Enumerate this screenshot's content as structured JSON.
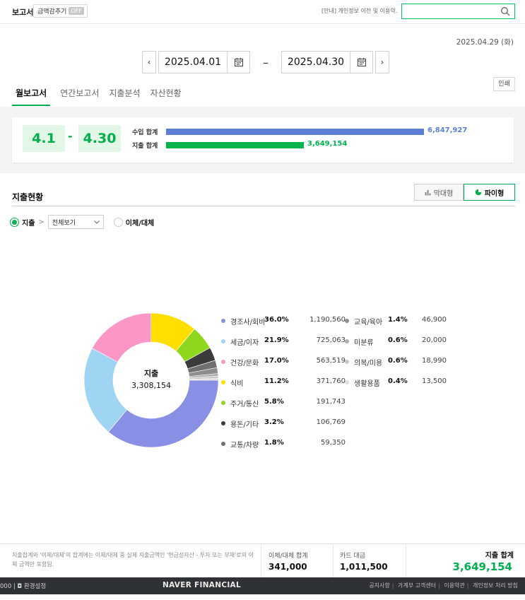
{
  "header": {
    "title": "보고서",
    "toggle_label": "금액감추기",
    "toggle_state": "OFF",
    "notice": "[안내] 개인정보 이전 및 이용약.",
    "search_placeholder": ""
  },
  "today": "2025.04.29 (화)",
  "period": {
    "prev": "‹",
    "start": "2025.04.01",
    "separator": "–",
    "end": "2025.04.30",
    "next": "›"
  },
  "tabs": [
    {
      "label": "월보고서",
      "active": true
    },
    {
      "label": "연간보고서",
      "active": false
    },
    {
      "label": "지출분석",
      "active": false
    },
    {
      "label": "자산현황",
      "active": false
    }
  ],
  "print_label": "인쇄",
  "summary": {
    "range_start": "4.1",
    "range_dash": "-",
    "range_end": "4.30",
    "income_label": "수입 합계",
    "income_value": "6,847,927",
    "income_amount": 6847927,
    "expense_label": "지출 합계",
    "expense_value": "3,649,154",
    "expense_amount": 3649154,
    "income_color": "#5b7fd4",
    "expense_color": "#00b44b"
  },
  "section": {
    "title": "지출현황",
    "bar_view_label": "막대형",
    "pie_view_label": "파이형",
    "active_view": "pie"
  },
  "filters": {
    "expense_label": "지출",
    "chevron": ">",
    "select_value": "전체보기",
    "transfer_label": "이체/대체"
  },
  "chart_data": {
    "type": "pie",
    "center_label": "지출",
    "center_value": "3,308,154",
    "slices": [
      {
        "name": "경조사/회비",
        "pct": "36.0%",
        "value": 1190560,
        "amount": "1,190,560",
        "color": "#8a8fe6"
      },
      {
        "name": "세금/이자",
        "pct": "21.9%",
        "value": 725063,
        "amount": "725,063",
        "color": "#9fd5f3"
      },
      {
        "name": "건강/문화",
        "pct": "17.0%",
        "value": 563519,
        "amount": "563,519",
        "color": "#fb96c6"
      },
      {
        "name": "식비",
        "pct": "11.2%",
        "value": 371760,
        "amount": "371,760",
        "color": "#ffde00"
      },
      {
        "name": "주거/통신",
        "pct": "5.8%",
        "value": 191743,
        "amount": "191,743",
        "color": "#8fd61f"
      },
      {
        "name": "용돈/기타",
        "pct": "3.2%",
        "value": 106769,
        "amount": "106,769",
        "color": "#3b3b3b"
      },
      {
        "name": "교통/차량",
        "pct": "1.8%",
        "value": 59350,
        "amount": "59,350",
        "color": "#707070"
      },
      {
        "name": "교육/육아",
        "pct": "1.4%",
        "value": 46900,
        "amount": "46,900",
        "color": "#8d8d8d"
      },
      {
        "name": "미분류",
        "pct": "0.6%",
        "value": 20000,
        "amount": "20,000",
        "color": "#adadad"
      },
      {
        "name": "의복/미용",
        "pct": "0.6%",
        "value": 18990,
        "amount": "18,990",
        "color": "#c9c9c9"
      },
      {
        "name": "생활용품",
        "pct": "0.4%",
        "value": 13500,
        "amount": "13,500",
        "color": "#dedede"
      }
    ]
  },
  "bottom": {
    "note": "지출합계와 '이체/대체'의 합계에는 이체/대체 중 실제 지출금액인 '현금성자산 - 투자 또는 부채'로의 이체 금액만 포함됨.",
    "transfer_label": "이체/대체 합계",
    "transfer_value": "341,000",
    "card_label": "카드 대금",
    "card_value": "1,011,500",
    "total_label": "지출 합계",
    "total_value": "3,649,154"
  },
  "footer": {
    "left": "000 | ◘ 환경설정",
    "brand": "NAVER FINANCIAL",
    "links": [
      "공지사항",
      "가계부 고객센터",
      "이용약관",
      "개인정보 처리 방침"
    ]
  }
}
